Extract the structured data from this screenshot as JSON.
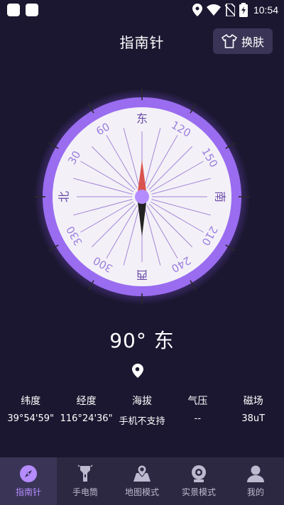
{
  "status_bar": {
    "time": "10:54",
    "icons": [
      "app-icon",
      "app-icon",
      "location-icon",
      "wifi-icon",
      "no-sim-icon",
      "battery-icon"
    ]
  },
  "header": {
    "title": "指南针",
    "skin_button_label": "换肤"
  },
  "compass": {
    "cardinals": {
      "east": "东",
      "south": "南",
      "west": "西",
      "north": "北"
    },
    "degree_labels": [
      "30",
      "60",
      "120",
      "150",
      "210",
      "240",
      "300",
      "330"
    ],
    "colors": {
      "ring": "#9a6cf0",
      "dial": "#f3f1f7",
      "needle_north": "#d9534f",
      "needle_south": "#222222",
      "lines": "#a585d8"
    }
  },
  "heading": {
    "degrees": "90°",
    "direction": "东"
  },
  "info": [
    {
      "label": "纬度",
      "value": "39°54'59\""
    },
    {
      "label": "经度",
      "value": "116°24'36\""
    },
    {
      "label": "海拔",
      "value": "手机不支持"
    },
    {
      "label": "气压",
      "value": "--"
    },
    {
      "label": "磁场",
      "value": "38uT"
    }
  ],
  "bottom_nav": [
    {
      "label": "指南针",
      "icon": "compass-icon",
      "active": true
    },
    {
      "label": "手电筒",
      "icon": "flashlight-icon",
      "active": false
    },
    {
      "label": "地图模式",
      "icon": "map-icon",
      "active": false
    },
    {
      "label": "实景模式",
      "icon": "camera-icon",
      "active": false
    },
    {
      "label": "我的",
      "icon": "user-icon",
      "active": false
    }
  ]
}
